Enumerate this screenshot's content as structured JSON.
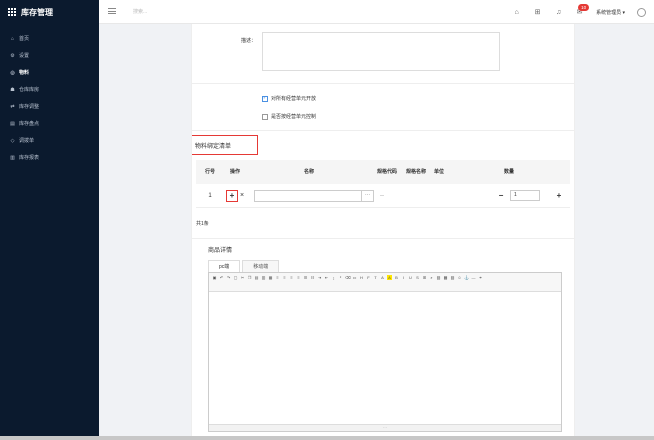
{
  "app": {
    "title": "库存管理"
  },
  "sidebar": {
    "items": [
      {
        "label": "首页",
        "icon": "home-icon",
        "glyph": "⌂"
      },
      {
        "label": "设置",
        "icon": "settings-icon",
        "glyph": "⚙"
      },
      {
        "label": "物料",
        "icon": "material-icon",
        "glyph": "◎",
        "active": true
      },
      {
        "label": "仓库库房",
        "icon": "warehouse-icon",
        "glyph": "☗"
      },
      {
        "label": "库存调整",
        "icon": "adjust-icon",
        "glyph": "⇄"
      },
      {
        "label": "库存盘点",
        "icon": "inventory-check-icon",
        "glyph": "▤"
      },
      {
        "label": "调拨单",
        "icon": "transfer-icon",
        "glyph": "◇"
      },
      {
        "label": "库存报表",
        "icon": "report-icon",
        "glyph": "▥"
      }
    ]
  },
  "topbar": {
    "search_placeholder": "搜索...",
    "notification_count": "10",
    "user_label": "系统管理员 ▾"
  },
  "form": {
    "desc_label": "描述：",
    "checkbox_all_units": "对所有经营单元开放",
    "checkbox_unit_control": "是否按经营单元控制"
  },
  "binding": {
    "section_title": "物料绑定清单",
    "headers": {
      "row_no": "行号",
      "operation": "操作",
      "name": "名称",
      "spec_code": "规格代码",
      "spec_name": "规格名称",
      "unit": "单位",
      "quantity": "数量"
    },
    "rows": [
      {
        "no": "1",
        "spec": "--",
        "qty": "1"
      }
    ],
    "total": "共1条"
  },
  "detail": {
    "title": "商品详情",
    "tabs": [
      "pc端",
      "移动端"
    ]
  }
}
